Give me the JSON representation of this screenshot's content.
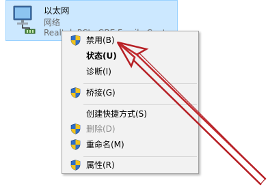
{
  "adapter": {
    "name": "以太网",
    "type": "网络",
    "device": "Realtek PCIe GBE Family Controller",
    "icon": "network-adapter-icon"
  },
  "menu": {
    "items": [
      {
        "label": "禁用(B)",
        "shield": true,
        "bold": false,
        "disabled": false
      },
      {
        "label": "状态(U)",
        "shield": false,
        "bold": true,
        "disabled": false
      },
      {
        "label": "诊断(I)",
        "shield": false,
        "bold": false,
        "disabled": false
      },
      {
        "label": "桥接(G)",
        "shield": true,
        "bold": false,
        "disabled": false
      },
      {
        "label": "创建快捷方式(S)",
        "shield": false,
        "bold": false,
        "disabled": false
      },
      {
        "label": "删除(D)",
        "shield": true,
        "bold": false,
        "disabled": true
      },
      {
        "label": "重命名(M)",
        "shield": true,
        "bold": false,
        "disabled": false
      },
      {
        "label": "属性(R)",
        "shield": true,
        "bold": false,
        "disabled": false
      }
    ]
  },
  "colors": {
    "selection": "#cce8ff",
    "menu_background": "#f2f2f2",
    "annotation_arrow": "#c0282d"
  }
}
